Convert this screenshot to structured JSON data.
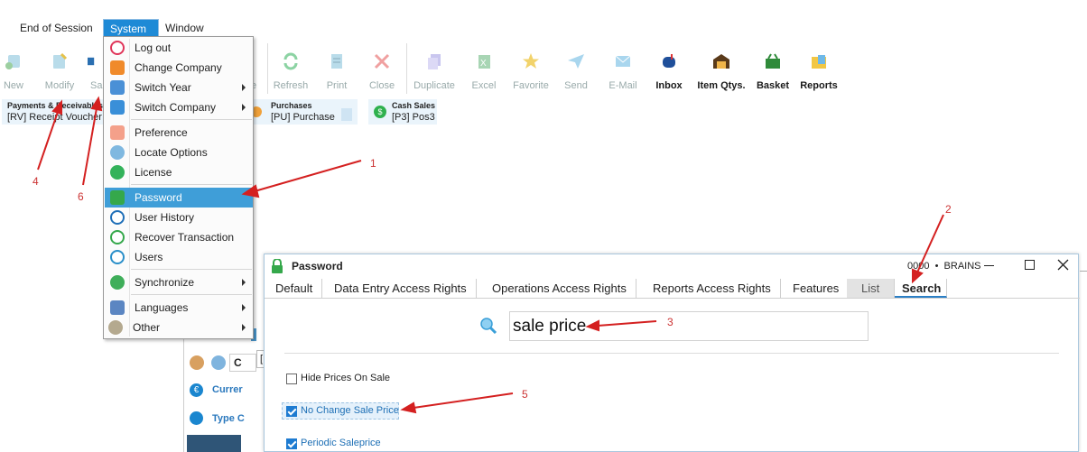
{
  "menubar": {
    "items": [
      "End of Session",
      "System",
      "Window"
    ]
  },
  "toolbar": {
    "buttons": [
      "New",
      "Modify",
      "Sa",
      "e",
      "Refresh",
      "Print",
      "Close",
      "Duplicate",
      "Excel",
      "Favorite",
      "Send",
      "E-Mail",
      "Inbox",
      "Item Qtys.",
      "Basket",
      "Reports"
    ]
  },
  "recent": [
    {
      "title": "Payments & Receivables",
      "subtitle": "[RV] Receipt Voucher"
    },
    {
      "title": "Purchases",
      "subtitle": "[PU] Purchase"
    },
    {
      "title": "Cash Sales",
      "subtitle": "[P3] Pos3"
    }
  ],
  "system_menu": {
    "items": [
      "Log out",
      "Change Company",
      "Switch Year",
      "Switch Company",
      "Preference",
      "Locate Options",
      "License",
      "Password",
      "User History",
      "Recover Transaction",
      "Users",
      "Synchronize",
      "Languages",
      "Other"
    ]
  },
  "background_window": {
    "items": [
      "Currer",
      "Type C"
    ],
    "field_char": "C",
    "bracket": "["
  },
  "dialog": {
    "title": "Password",
    "status": "0000  •  BRAINS",
    "tabs": [
      "Default",
      "Data Entry Access Rights",
      "Operations Access Rights",
      "Reports Access Rights",
      "Features",
      "List",
      "Search"
    ],
    "search_value": "sale price",
    "checkboxes": [
      {
        "label": "Hide Prices On Sale",
        "checked": false
      },
      {
        "label": "No Change Sale Price",
        "checked": true
      },
      {
        "label": "Periodic Saleprice",
        "checked": true
      }
    ]
  },
  "annotations": [
    "1",
    "2",
    "3",
    "4",
    "5",
    "6"
  ],
  "colors": {
    "accent": "#1e8ad6",
    "highlight": "#3f9ed8",
    "arrow": "#d42020"
  }
}
